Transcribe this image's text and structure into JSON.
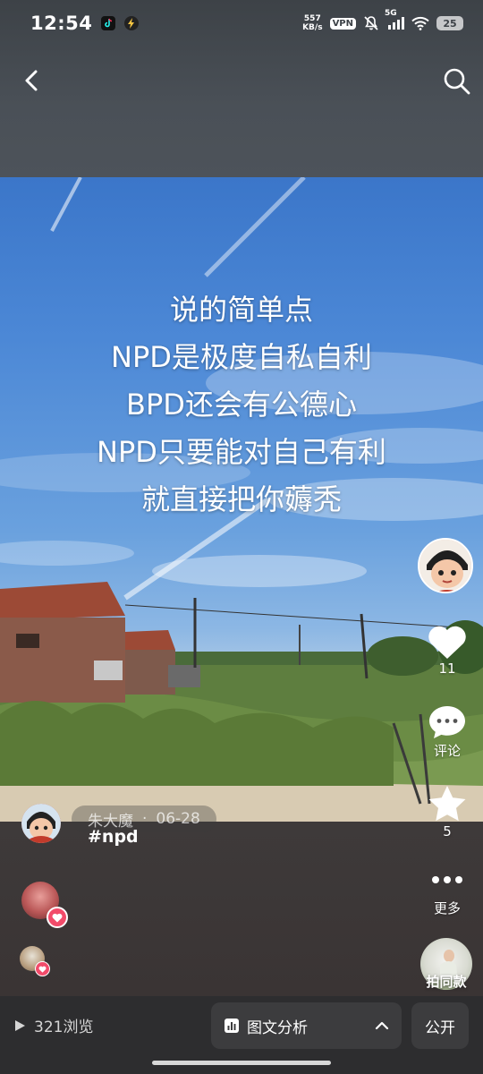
{
  "status_bar": {
    "time": "12:54",
    "net_speed_value": "557",
    "net_speed_unit": "KB/s",
    "vpn": "VPN",
    "network": "5G",
    "battery": "25",
    "icons": [
      "tiktok-icon",
      "lightning-icon",
      "mute-icon",
      "signal-icon",
      "wifi-icon"
    ]
  },
  "nav": {
    "back_icon": "chevron-left-icon",
    "search_icon": "search-icon"
  },
  "post": {
    "overlay_lines": [
      "说的简单点",
      "NPD是极度自私自利",
      "BPD还会有公德心",
      "NPD只要能对自己有利",
      "就直接把你薅秃"
    ],
    "author": "朱大魔",
    "separator": "·",
    "date": "06-28",
    "hashtag": "#npd"
  },
  "actions": {
    "like_count": "11",
    "comment_label": "评论",
    "favorite_count": "5",
    "more_label": "更多",
    "same_style_label": "拍同款"
  },
  "toolbar": {
    "views": "321浏览",
    "analysis_label": "图文分析",
    "public_label": "公开"
  },
  "colors": {
    "heart_badge": "#f24b6a",
    "toolbar_bg": "#2d2d2f",
    "button_bg": "#3c3c3e"
  }
}
